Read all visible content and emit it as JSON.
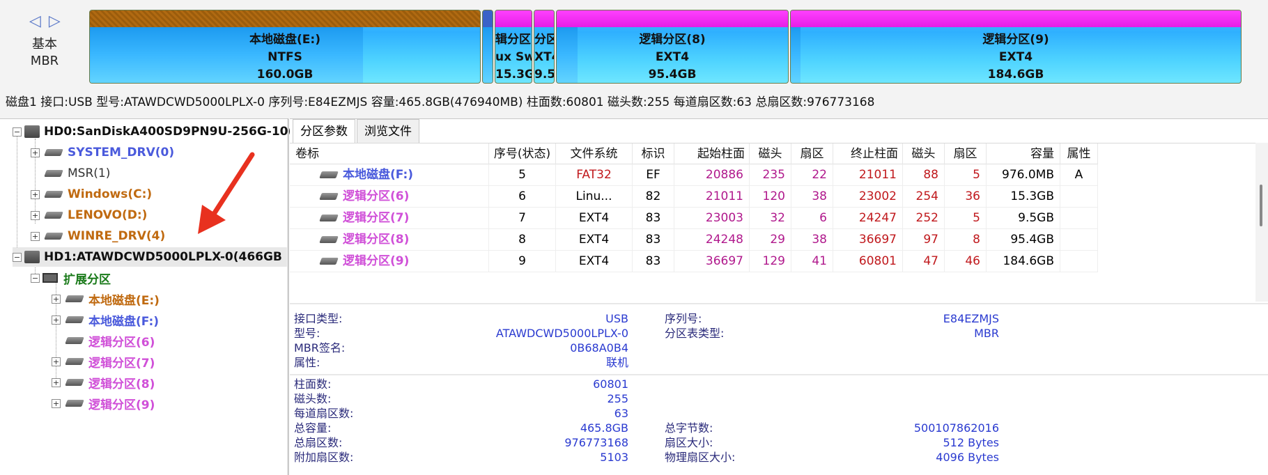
{
  "diskmap": {
    "nav": "◁ ▷",
    "disk_type_line1": "基本",
    "disk_type_line2": "MBR",
    "segments": [
      {
        "name": "本地磁盘(E:)",
        "fs": "NTFS",
        "size": "160.0GB"
      },
      {
        "name": "",
        "fs": "",
        "size": ""
      },
      {
        "name": "辑分区",
        "fs": "ux Sw",
        "size": "15.3GB"
      },
      {
        "name": "分区",
        "fs": "XT4",
        "size": "9.5G"
      },
      {
        "name": "逻辑分区(8)",
        "fs": "EXT4",
        "size": "95.4GB"
      },
      {
        "name": "逻辑分区(9)",
        "fs": "EXT4",
        "size": "184.6GB"
      }
    ]
  },
  "diskinfo": "磁盘1 接口:USB  型号:ATAWDCWD5000LPLX-0  序列号:E84EZMJS  容量:465.8GB(476940MB)  柱面数:60801  磁头数:255  每道扇区数:63  总扇区数:976773168",
  "tree": {
    "hd0": "HD0:SanDiskA400SD9PN9U-256G-10(",
    "hd0_parts": [
      "SYSTEM_DRV(0)",
      "MSR(1)",
      "Windows(C:)",
      "LENOVO(D:)",
      "WINRE_DRV(4)"
    ],
    "hd1": "HD1:ATAWDCWD5000LPLX-0(466GB",
    "ext": "扩展分区",
    "hd1_parts": [
      "本地磁盘(E:)",
      "本地磁盘(F:)",
      "逻辑分区(6)",
      "逻辑分区(7)",
      "逻辑分区(8)",
      "逻辑分区(9)"
    ]
  },
  "tabs": [
    "分区参数",
    "浏览文件"
  ],
  "table": {
    "headers": [
      "卷标",
      "序号(状态)",
      "文件系统",
      "标识",
      "起始柱面",
      "磁头",
      "扇区",
      "终止柱面",
      "磁头",
      "扇区",
      "容量",
      "属性"
    ],
    "rows": [
      {
        "label": "本地磁盘(F:)",
        "num": "5",
        "fs": "FAT32",
        "id": "EF",
        "sc": "20886",
        "sh": "235",
        "ss": "22",
        "ec": "21011",
        "eh": "88",
        "es": "5",
        "cap": "976.0MB",
        "attr": "A"
      },
      {
        "label": "逻辑分区(6)",
        "num": "6",
        "fs": "Linu...",
        "id": "82",
        "sc": "21011",
        "sh": "120",
        "ss": "38",
        "ec": "23002",
        "eh": "254",
        "es": "36",
        "cap": "15.3GB",
        "attr": ""
      },
      {
        "label": "逻辑分区(7)",
        "num": "7",
        "fs": "EXT4",
        "id": "83",
        "sc": "23003",
        "sh": "32",
        "ss": "6",
        "ec": "24247",
        "eh": "252",
        "es": "5",
        "cap": "9.5GB",
        "attr": ""
      },
      {
        "label": "逻辑分区(8)",
        "num": "8",
        "fs": "EXT4",
        "id": "83",
        "sc": "24248",
        "sh": "29",
        "ss": "38",
        "ec": "36697",
        "eh": "97",
        "es": "8",
        "cap": "95.4GB",
        "attr": ""
      },
      {
        "label": "逻辑分区(9)",
        "num": "9",
        "fs": "EXT4",
        "id": "83",
        "sc": "36697",
        "sh": "129",
        "ss": "41",
        "ec": "60801",
        "eh": "47",
        "es": "46",
        "cap": "184.6GB",
        "attr": ""
      }
    ]
  },
  "props1": {
    "iface_label": "接口类型:",
    "iface": "USB",
    "model_label": "型号:",
    "model": "ATAWDCWD5000LPLX-0",
    "mbrsig_label": "MBR签名:",
    "mbrsig": "0B68A0B4",
    "attr_label": "属性:",
    "attr": "联机",
    "serial_label": "序列号:",
    "serial": "E84EZMJS",
    "pttype_label": "分区表类型:",
    "pttype": "MBR"
  },
  "props2": {
    "cyl_label": "柱面数:",
    "cyl": "60801",
    "heads_label": "磁头数:",
    "heads": "255",
    "spt_label": "每道扇区数:",
    "spt": "63",
    "cap_label": "总容量:",
    "cap": "465.8GB",
    "totsec_label": "总扇区数:",
    "totsec": "976773168",
    "extra_label": "附加扇区数:",
    "extra": "5103",
    "bytes_label": "总字节数:",
    "bytes": "500107862016",
    "secsize_label": "扇区大小:",
    "secsize": "512 Bytes",
    "physsec_label": "物理扇区大小:",
    "physsec": "4096 Bytes"
  }
}
